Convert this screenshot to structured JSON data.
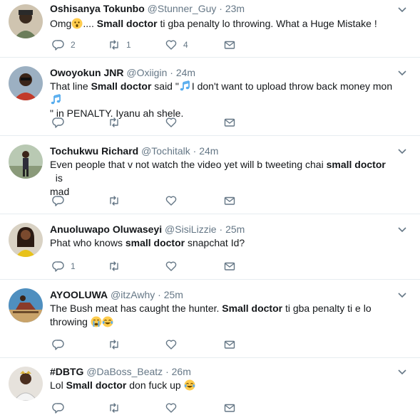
{
  "tweets": [
    {
      "name": "Oshisanya Tokunbo",
      "handle": "@Stunner_Guy",
      "dot": "·",
      "time": "23m",
      "text": {
        "pre": "Omg",
        "mid": ".... ",
        "bold": "Small doctor",
        "post": " ti gba penalty lo throwing. What a Huge Mistake !"
      },
      "counts": {
        "reply": "2",
        "retweet": "1",
        "like": "4"
      }
    },
    {
      "name": "Owoyokun JNR",
      "handle": "@Oxiigin",
      "dot": "·",
      "time": "24m",
      "text": {
        "pre": "That line ",
        "bold": "Small doctor",
        "mid": " said \"",
        "post": "I don't want to upload throw back money mon",
        "line2": "\" in PENALTY. Iyanu ah shele."
      },
      "counts": {
        "reply": "",
        "retweet": "",
        "like": ""
      }
    },
    {
      "name": "Tochukwu Richard",
      "handle": "@Tochitalk",
      "dot": "·",
      "time": "24m",
      "text": {
        "pre": "Even people that v not watch the video yet will b tweeting chai ",
        "bold": "small doctor",
        "post": "  is",
        "line2": "mad"
      },
      "counts": {
        "reply": "",
        "retweet": "",
        "like": ""
      }
    },
    {
      "name": "Anuoluwapo Oluwaseyi",
      "handle": "@SisiLizzie",
      "dot": "·",
      "time": "25m",
      "text": {
        "pre": "Phat who knows ",
        "bold": "small doctor",
        "post": " snapchat Id?"
      },
      "counts": {
        "reply": "1",
        "retweet": "",
        "like": ""
      }
    },
    {
      "name": "AYOOLUWA",
      "handle": "@itzAwhy",
      "dot": "·",
      "time": "25m",
      "text": {
        "pre": "The Bush meat has caught the hunter. ",
        "bold": "Small doctor",
        "post": " ti gba penalty ti e lo",
        "line2": "throwing "
      },
      "counts": {
        "reply": "",
        "retweet": "",
        "like": ""
      }
    },
    {
      "name": "#DBTG",
      "handle": "@DaBoss_Beatz",
      "dot": "·",
      "time": "26m",
      "text": {
        "pre": "Lol ",
        "bold": "Small doctor",
        "post": " don fuck up "
      },
      "counts": {
        "reply": "",
        "retweet": "",
        "like": ""
      }
    }
  ],
  "colors": {
    "text": "#14171a",
    "muted": "#657786",
    "divider": "#e6ecf0",
    "emoji_yellow": "#ffcc4d",
    "note_blue": "#55acee"
  },
  "icons": [
    "reply-icon",
    "retweet-icon",
    "like-icon",
    "direct-message-icon",
    "chevron-down-icon"
  ]
}
